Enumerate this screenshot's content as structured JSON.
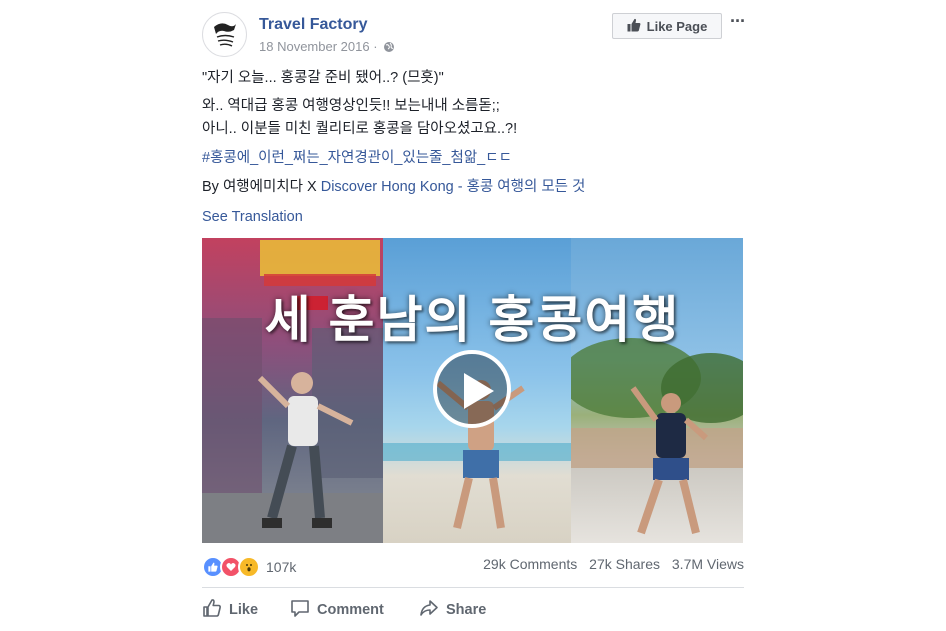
{
  "post": {
    "page_name": "Travel Factory",
    "date": "18 November 2016",
    "date_separator": "·",
    "like_page_label": "Like Page",
    "more_label": "···",
    "text": {
      "line1": "\"자기 오늘... 홍콩갈 준비 됐어..? (므흣)\"",
      "line2": "와.. 역대급 홍콩 여행영상인듯!! 보는내내 소름돋;;",
      "line3": "아니.. 이분들 미친 퀄리티로 홍콩을 담아오셨고요..?!",
      "hashtag": "#홍콩에_이런_쩌는_자연경관이_있는줄_첨앎_ㄷㄷ",
      "credit_prefix": "By 여행에미치다 X ",
      "credit_link": "Discover Hong Kong - 홍콩 여행의 모든 것",
      "see_translation": "See Translation"
    },
    "video": {
      "title": "세 훈남의 홍콩여행"
    },
    "stats": {
      "reaction_count": "107k",
      "comments": "29k Comments",
      "shares": "27k Shares",
      "views": "3.7M Views",
      "reactions": [
        "like",
        "love",
        "wow"
      ]
    },
    "actions": {
      "like": "Like",
      "comment": "Comment",
      "share": "Share"
    }
  },
  "colors": {
    "link": "#365899",
    "text": "#1d2129",
    "meta": "#90949c",
    "like_reaction": "#5890ff",
    "love_reaction": "#f25268",
    "wow_reaction": "#f7b928"
  }
}
